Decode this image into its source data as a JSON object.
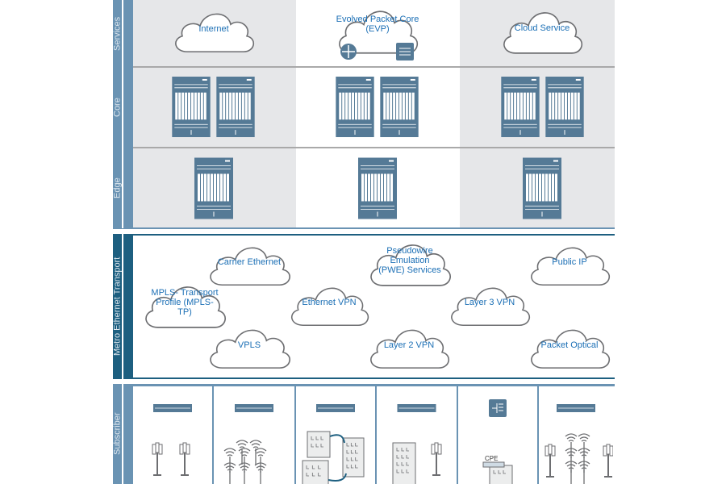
{
  "layers": {
    "services": "Services",
    "core": "Core",
    "edge": "Edge",
    "metro": "Metro Ethernet Transport",
    "subscriber": "Subscriber"
  },
  "services_clouds": [
    "Internet",
    "Evolved Packet Core (EVP)",
    "Cloud Service"
  ],
  "metro_clouds": {
    "carrier_ethernet": "Carrier Ethernet",
    "mpls_tp": "MPLS- Transport Profile (MPLS-TP)",
    "ethernet_vpn": "Ethernet VPN",
    "vpls": "VPLS",
    "pwe": "Pseudowire Emulation (PWE) Services",
    "layer3": "Layer 3 VPN",
    "layer2": "Layer 2 VPN",
    "public_ip": "Public IP",
    "packet_optical": "Packet Optical"
  },
  "subscriber": {
    "cpe_label": "CPE"
  },
  "colors": {
    "layer_bar": "#6a93b3",
    "metro_bar": "#1d5f80",
    "cloud_text": "#1b6fb5",
    "device": "#557a96"
  }
}
